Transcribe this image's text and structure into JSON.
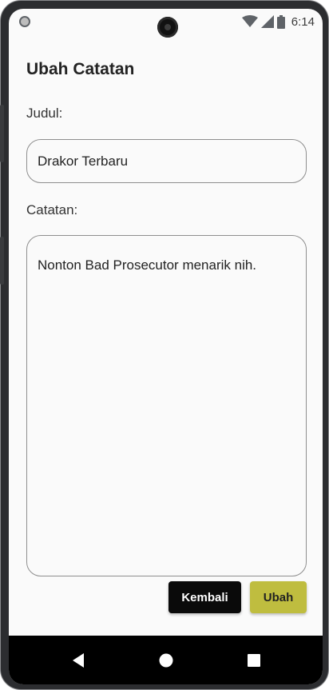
{
  "status_bar": {
    "time": "6:14",
    "icons": [
      "wifi-icon",
      "signal-icon",
      "battery-icon"
    ]
  },
  "page": {
    "title": "Ubah Catatan"
  },
  "form": {
    "title_label": "Judul:",
    "title_value": "Drakor Terbaru",
    "note_label": "Catatan:",
    "note_value": "Nonton Bad Prosecutor menarik nih."
  },
  "actions": {
    "back_label": "Kembali",
    "save_label": "Ubah"
  },
  "nav": {
    "items": [
      "back-icon",
      "home-icon",
      "recents-icon"
    ]
  },
  "colors": {
    "back_button": "#0a0a0a",
    "save_button": "#bfbd3f",
    "background": "#fafafa"
  }
}
